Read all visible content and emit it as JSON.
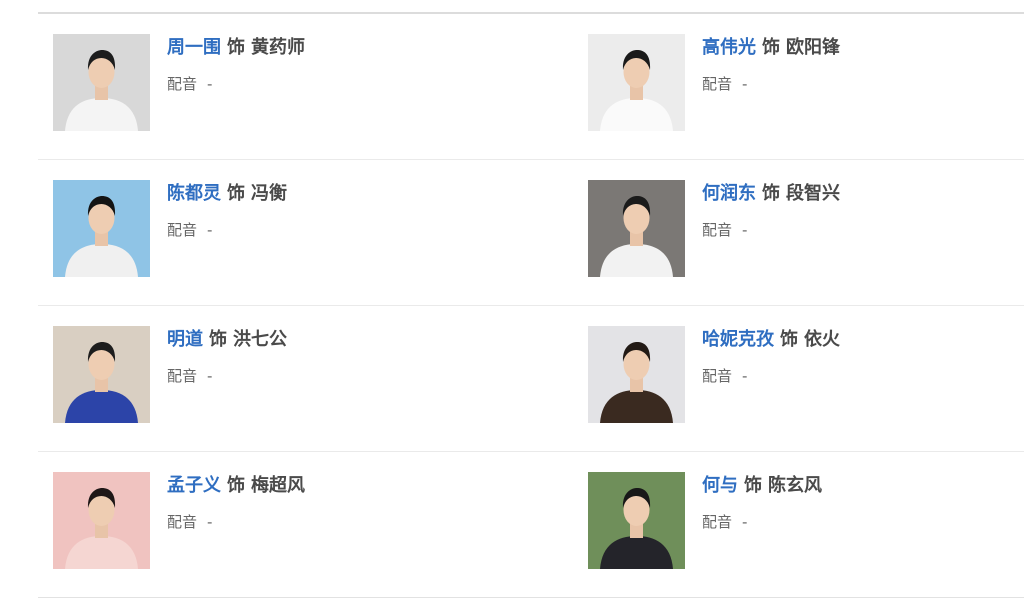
{
  "cast": [
    [
      {
        "actor": "周一围",
        "plays": "饰",
        "role": "黄药师",
        "voice_label": "配音",
        "voice_value": "-",
        "photo": {
          "bg": "#d8d8d8",
          "shirt": "#f4f4f4",
          "hair": "#1d1d1d"
        }
      },
      {
        "actor": "高伟光",
        "plays": "饰",
        "role": "欧阳锋",
        "voice_label": "配音",
        "voice_value": "-",
        "photo": {
          "bg": "#ececec",
          "shirt": "#fafafa",
          "hair": "#1a1a1a"
        }
      }
    ],
    [
      {
        "actor": "陈都灵",
        "plays": "饰",
        "role": "冯衡",
        "voice_label": "配音",
        "voice_value": "-",
        "photo": {
          "bg": "#8fc4e6",
          "shirt": "#f0f0f0",
          "hair": "#141414"
        }
      },
      {
        "actor": "何润东",
        "plays": "饰",
        "role": "段智兴",
        "voice_label": "配音",
        "voice_value": "-",
        "photo": {
          "bg": "#7b7875",
          "shirt": "#f2f2f2",
          "hair": "#1b1b1b"
        }
      }
    ],
    [
      {
        "actor": "明道",
        "plays": "饰",
        "role": "洪七公",
        "voice_label": "配音",
        "voice_value": "-",
        "photo": {
          "bg": "#d9cfc2",
          "shirt": "#2c44a8",
          "hair": "#1d1d1d"
        }
      },
      {
        "actor": "哈妮克孜",
        "plays": "饰",
        "role": "依火",
        "voice_label": "配音",
        "voice_value": "-",
        "photo": {
          "bg": "#e3e3e6",
          "shirt": "#3a2a20",
          "hair": "#221a15"
        }
      }
    ],
    [
      {
        "actor": "孟子义",
        "plays": "饰",
        "role": "梅超风",
        "voice_label": "配音",
        "voice_value": "-",
        "photo": {
          "bg": "#f0c3c0",
          "shirt": "#f5d6d2",
          "hair": "#1f1717"
        }
      },
      {
        "actor": "何与",
        "plays": "饰",
        "role": "陈玄风",
        "voice_label": "配音",
        "voice_value": "-",
        "photo": {
          "bg": "#6f8f5a",
          "shirt": "#24242a",
          "hair": "#181818"
        }
      }
    ]
  ]
}
